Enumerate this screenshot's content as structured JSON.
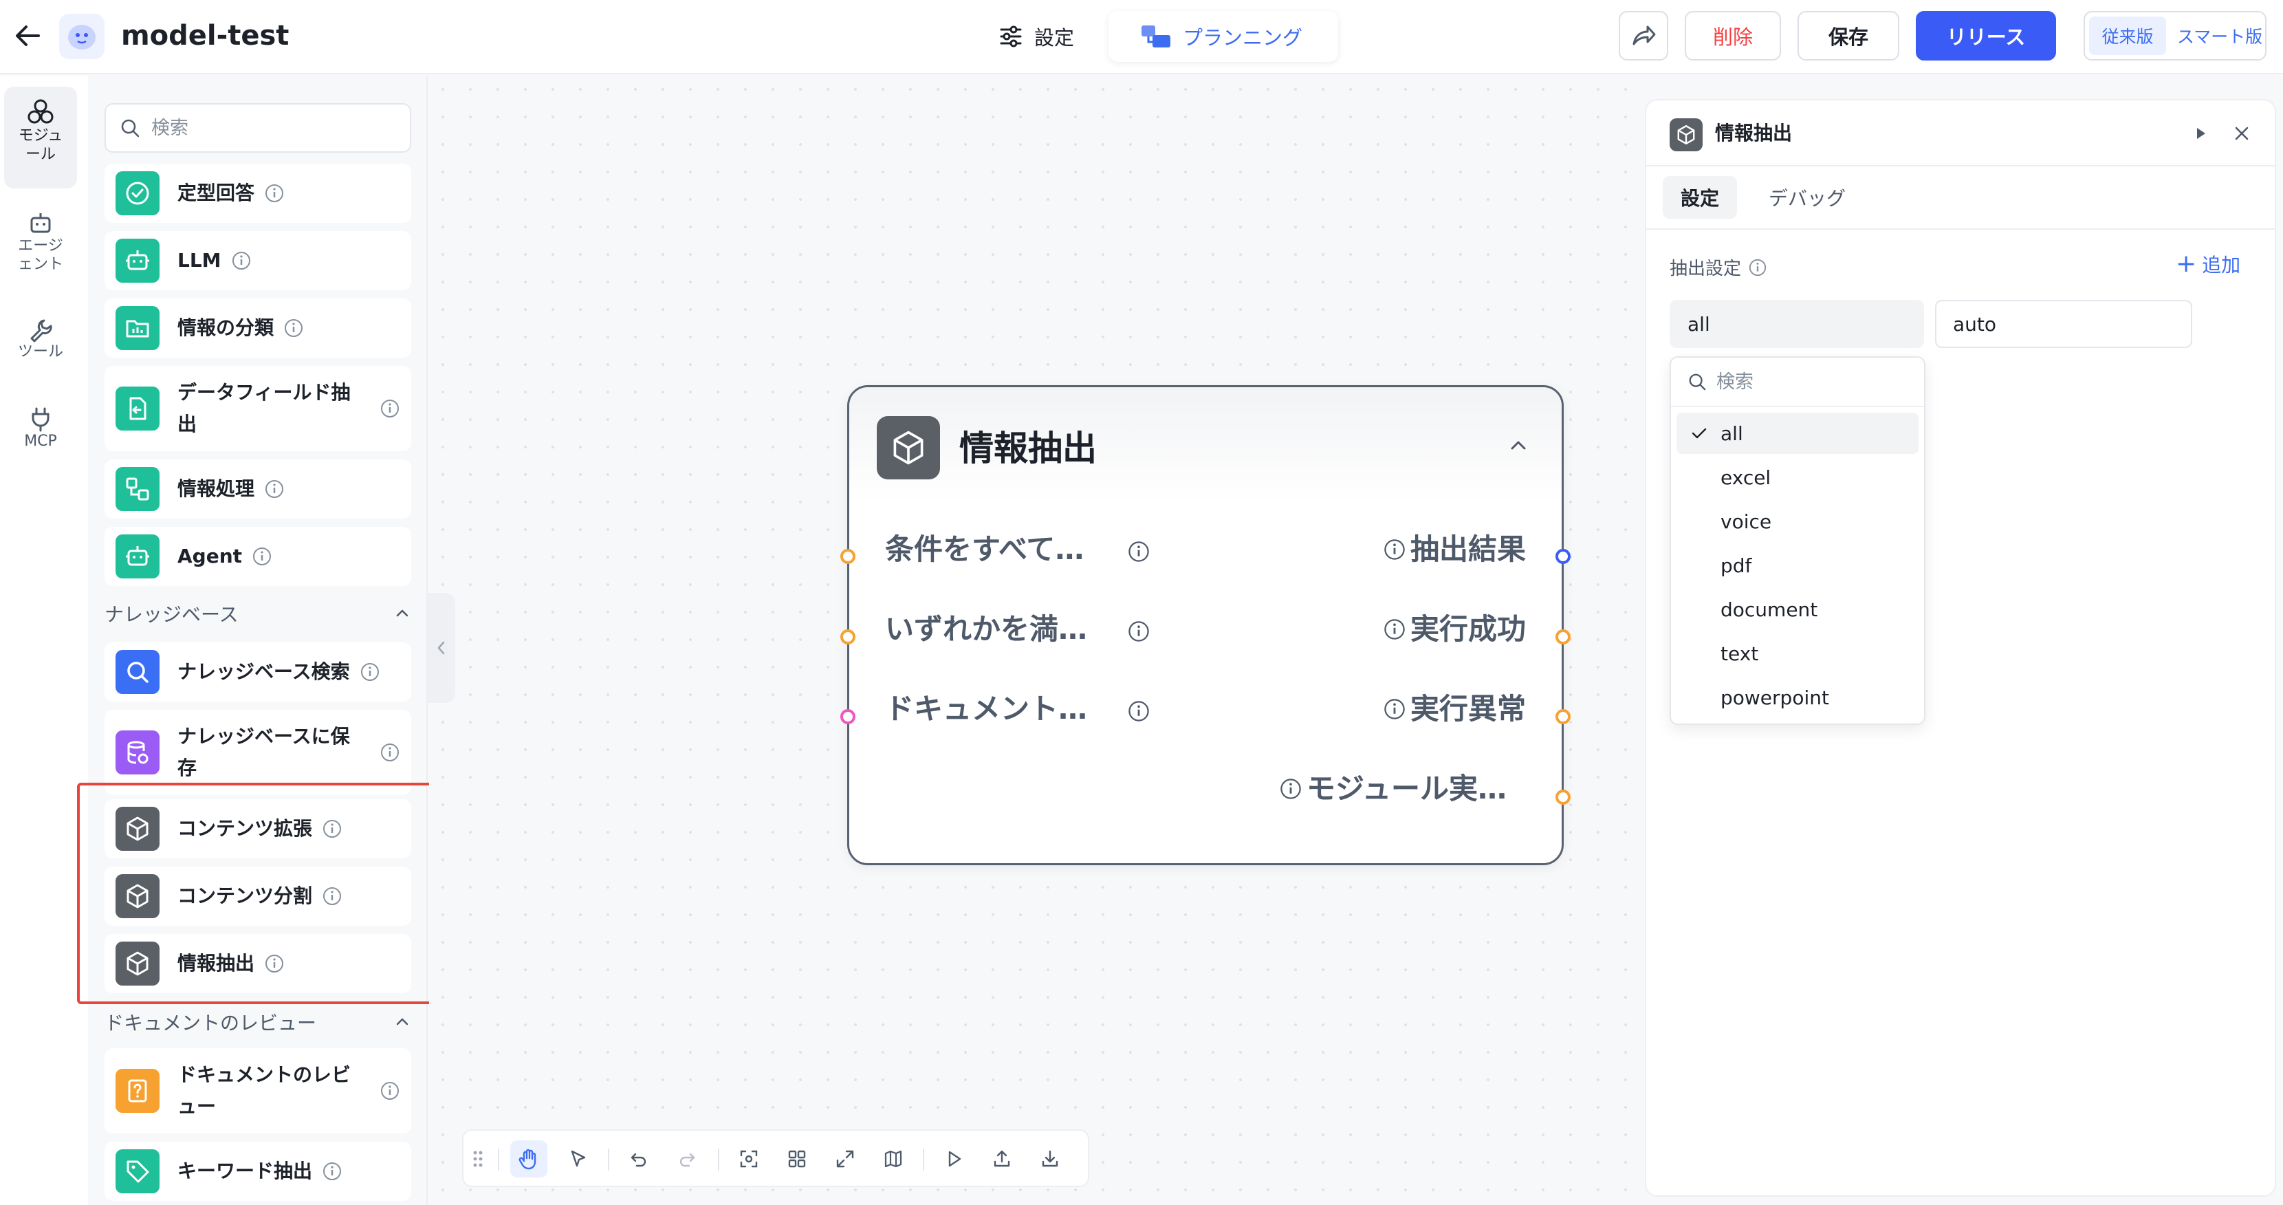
{
  "header": {
    "app_title": "model-test",
    "mode_tabs": {
      "settings": "設定",
      "planning": "プランニング"
    },
    "buttons": {
      "delete": "削除",
      "save": "保存",
      "release": "リリース"
    },
    "version": {
      "classic": "従来版",
      "smart": "スマート版"
    }
  },
  "rail": {
    "items": [
      {
        "label": "モジュール",
        "icon": "module-icon",
        "active": true
      },
      {
        "label": "エージェント",
        "icon": "robot-icon",
        "active": false
      },
      {
        "label": "ツール",
        "icon": "wrench-icon",
        "active": false
      },
      {
        "label": "MCP",
        "icon": "plug-icon",
        "active": false
      }
    ]
  },
  "module_panel": {
    "search_placeholder": "検索",
    "items": [
      {
        "label": "定型回答",
        "icon": "check-circle-icon",
        "color": "#1fbf9a"
      },
      {
        "label": "LLM",
        "icon": "robot-icon",
        "color": "#1fbf9a"
      },
      {
        "label": "情報の分類",
        "icon": "folder-chart-icon",
        "color": "#1fbf9a"
      },
      {
        "label": "データフィールド抽出",
        "icon": "file-import-icon",
        "color": "#1fbf9a"
      },
      {
        "label": "情報処理",
        "icon": "flow-icon",
        "color": "#1fbf9a"
      },
      {
        "label": "Agent",
        "icon": "robot-icon",
        "color": "#1fbf9a"
      }
    ],
    "sections": [
      {
        "title": "ナレッジベース",
        "items": [
          {
            "label": "ナレッジベース検索",
            "icon": "search-icon",
            "color": "#3a6ff5"
          },
          {
            "label": "ナレッジベースに保存",
            "icon": "database-icon",
            "color": "#9b5cf6"
          },
          {
            "label": "コンテンツ拡張",
            "icon": "cube-icon",
            "color": "#5b5f66"
          },
          {
            "label": "コンテンツ分割",
            "icon": "cube-icon",
            "color": "#5b5f66"
          },
          {
            "label": "情報抽出",
            "icon": "cube-icon",
            "color": "#5b5f66"
          }
        ]
      },
      {
        "title": "ドキュメントのレビュー",
        "items": [
          {
            "label": "ドキュメントのレビュー",
            "icon": "question-doc-icon",
            "color": "#f7a130"
          },
          {
            "label": "キーワード抽出",
            "icon": "tag-icon",
            "color": "#1fbf9a"
          }
        ]
      }
    ]
  },
  "node": {
    "title": "情報抽出",
    "inputs": [
      "条件をすべて…",
      "いずれかを満…",
      "ドキュメント…"
    ],
    "outputs": [
      "抽出結果",
      "実行成功",
      "実行異常",
      "モジュール実…"
    ]
  },
  "right_panel": {
    "title": "情報抽出",
    "tabs": {
      "settings": "設定",
      "debug": "デバッグ"
    },
    "field_label": "抽出設定",
    "add_label": "追加",
    "select1_value": "all",
    "select2_value": "auto",
    "dropdown": {
      "search_placeholder": "検索",
      "options": [
        "all",
        "excel",
        "voice",
        "pdf",
        "document",
        "text",
        "powerpoint"
      ],
      "selected": "all"
    }
  },
  "colors": {
    "accent": "#3a5bf5",
    "danger": "#f53f3f",
    "highlight": "#e8453c",
    "port_orange": "#f7a130"
  }
}
